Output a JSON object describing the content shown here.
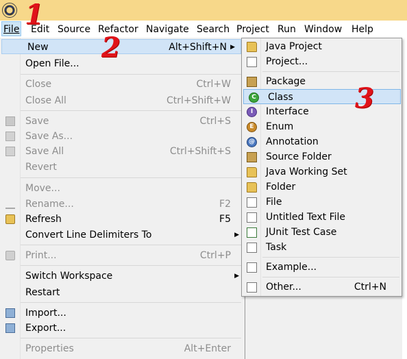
{
  "menubar": {
    "items": [
      "File",
      "Edit",
      "Source",
      "Refactor",
      "Navigate",
      "Search",
      "Project",
      "Run",
      "Window",
      "Help"
    ]
  },
  "file_menu": {
    "new": {
      "label": "New",
      "shortcut": "Alt+Shift+N"
    },
    "open_file": {
      "label": "Open File..."
    },
    "close": {
      "label": "Close",
      "shortcut": "Ctrl+W"
    },
    "close_all": {
      "label": "Close All",
      "shortcut": "Ctrl+Shift+W"
    },
    "save": {
      "label": "Save",
      "shortcut": "Ctrl+S"
    },
    "save_as": {
      "label": "Save As..."
    },
    "save_all": {
      "label": "Save All",
      "shortcut": "Ctrl+Shift+S"
    },
    "revert": {
      "label": "Revert"
    },
    "move": {
      "label": "Move..."
    },
    "rename": {
      "label": "Rename...",
      "shortcut": "F2"
    },
    "refresh": {
      "label": "Refresh",
      "shortcut": "F5"
    },
    "convert": {
      "label": "Convert Line Delimiters To"
    },
    "print": {
      "label": "Print...",
      "shortcut": "Ctrl+P"
    },
    "switch_workspace": {
      "label": "Switch Workspace"
    },
    "restart": {
      "label": "Restart"
    },
    "import": {
      "label": "Import..."
    },
    "export": {
      "label": "Export..."
    },
    "properties": {
      "label": "Properties",
      "shortcut": "Alt+Enter"
    }
  },
  "new_submenu": {
    "java_project": "Java Project",
    "project": "Project...",
    "package": "Package",
    "class": "Class",
    "interface": "Interface",
    "enum": "Enum",
    "annotation": "Annotation",
    "source_folder": "Source Folder",
    "java_working_set": "Java Working Set",
    "folder": "Folder",
    "file": "File",
    "untitled_text_file": "Untitled Text File",
    "junit_test_case": "JUnit Test Case",
    "task": "Task",
    "example": "Example...",
    "other": {
      "label": "Other...",
      "shortcut": "Ctrl+N"
    }
  },
  "annotations": {
    "one": "1",
    "two": "2",
    "three": "3"
  },
  "colors": {
    "highlight": "#d1e4f7",
    "titlebar": "#f7d88a",
    "annotation": "#e0131a"
  }
}
